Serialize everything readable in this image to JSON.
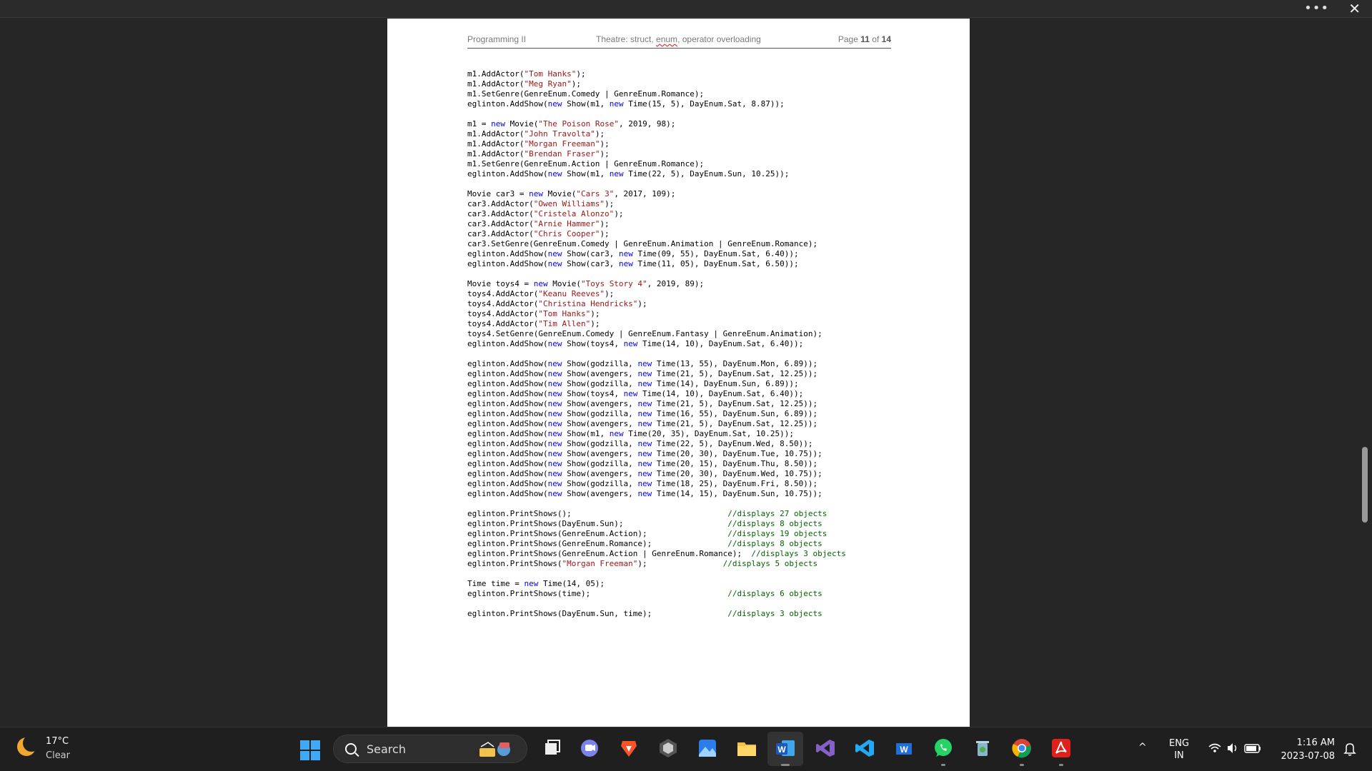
{
  "window": {
    "more_label": "•••",
    "close_label": "✕"
  },
  "document": {
    "header": {
      "left": "Programming II",
      "mid": "Theatre: struct, enum, operator overloading",
      "mid_pre": "Theatre: struct, ",
      "mid_squiggle": "enum",
      "mid_post": ", operator overloading",
      "page_word": "Page",
      "page_num": "11",
      "of_word": "of",
      "page_total": "14"
    },
    "code_lines": [
      [
        [
          "m1.AddActor(",
          ""
        ],
        [
          "\"Tom Hanks\"",
          "str"
        ],
        [
          ");",
          ""
        ]
      ],
      [
        [
          "m1.AddActor(",
          ""
        ],
        [
          "\"Meg Ryan\"",
          "str"
        ],
        [
          ");",
          ""
        ]
      ],
      [
        [
          "m1.SetGenre(GenreEnum.Comedy | GenreEnum.Romance);",
          ""
        ]
      ],
      [
        [
          "eglinton.AddShow(",
          ""
        ],
        [
          "new",
          "kw"
        ],
        [
          " Show(m1, ",
          ""
        ],
        [
          "new",
          "kw"
        ],
        [
          " Time(15, 5), DayEnum.Sat, 8.87));",
          ""
        ]
      ],
      [],
      [
        [
          "m1 = ",
          ""
        ],
        [
          "new",
          "kw"
        ],
        [
          " Movie(",
          ""
        ],
        [
          "\"The Poison Rose\"",
          "str"
        ],
        [
          ", 2019, 98);",
          ""
        ]
      ],
      [
        [
          "m1.AddActor(",
          ""
        ],
        [
          "\"John Travolta\"",
          "str"
        ],
        [
          ");",
          ""
        ]
      ],
      [
        [
          "m1.AddActor(",
          ""
        ],
        [
          "\"Morgan Freeman\"",
          "str"
        ],
        [
          ");",
          ""
        ]
      ],
      [
        [
          "m1.AddActor(",
          ""
        ],
        [
          "\"Brendan Fraser\"",
          "str"
        ],
        [
          ");",
          ""
        ]
      ],
      [
        [
          "m1.SetGenre(GenreEnum.Action | GenreEnum.Romance);",
          ""
        ]
      ],
      [
        [
          "eglinton.AddShow(",
          ""
        ],
        [
          "new",
          "kw"
        ],
        [
          " Show(m1, ",
          ""
        ],
        [
          "new",
          "kw"
        ],
        [
          " Time(22, 5), DayEnum.Sun, 10.25));",
          ""
        ]
      ],
      [],
      [
        [
          "Movie car3 = ",
          ""
        ],
        [
          "new",
          "kw"
        ],
        [
          " Movie(",
          ""
        ],
        [
          "\"Cars 3\"",
          "str"
        ],
        [
          ", 2017, 109);",
          ""
        ]
      ],
      [
        [
          "car3.AddActor(",
          ""
        ],
        [
          "\"Owen Williams\"",
          "str"
        ],
        [
          ");",
          ""
        ]
      ],
      [
        [
          "car3.AddActor(",
          ""
        ],
        [
          "\"Cristela Alonzo\"",
          "str"
        ],
        [
          ");",
          ""
        ]
      ],
      [
        [
          "car3.AddActor(",
          ""
        ],
        [
          "\"Arnie Hammer\"",
          "str"
        ],
        [
          ");",
          ""
        ]
      ],
      [
        [
          "car3.AddActor(",
          ""
        ],
        [
          "\"Chris Cooper\"",
          "str"
        ],
        [
          ");",
          ""
        ]
      ],
      [
        [
          "car3.SetGenre(GenreEnum.Comedy | GenreEnum.Animation | GenreEnum.Romance);",
          ""
        ]
      ],
      [
        [
          "eglinton.AddShow(",
          ""
        ],
        [
          "new",
          "kw"
        ],
        [
          " Show(car3, ",
          ""
        ],
        [
          "new",
          "kw"
        ],
        [
          " Time(09, 55), DayEnum.Sat, 6.40));",
          ""
        ]
      ],
      [
        [
          "eglinton.AddShow(",
          ""
        ],
        [
          "new",
          "kw"
        ],
        [
          " Show(car3, ",
          ""
        ],
        [
          "new",
          "kw"
        ],
        [
          " Time(11, 05), DayEnum.Sat, 6.50));",
          ""
        ]
      ],
      [],
      [
        [
          "Movie toys4 = ",
          ""
        ],
        [
          "new",
          "kw"
        ],
        [
          " Movie(",
          ""
        ],
        [
          "\"Toys Story 4\"",
          "str"
        ],
        [
          ", 2019, 89);",
          ""
        ]
      ],
      [
        [
          "toys4.AddActor(",
          ""
        ],
        [
          "\"Keanu Reeves\"",
          "str"
        ],
        [
          ");",
          ""
        ]
      ],
      [
        [
          "toys4.AddActor(",
          ""
        ],
        [
          "\"Christina Hendricks\"",
          "str"
        ],
        [
          ");",
          ""
        ]
      ],
      [
        [
          "toys4.AddActor(",
          ""
        ],
        [
          "\"Tom Hanks\"",
          "str"
        ],
        [
          ");",
          ""
        ]
      ],
      [
        [
          "toys4.AddActor(",
          ""
        ],
        [
          "\"Tim Allen\"",
          "str"
        ],
        [
          ");",
          ""
        ]
      ],
      [
        [
          "toys4.SetGenre(GenreEnum.Comedy | GenreEnum.Fantasy | GenreEnum.Animation);",
          ""
        ]
      ],
      [
        [
          "eglinton.AddShow(",
          ""
        ],
        [
          "new",
          "kw"
        ],
        [
          " Show(toys4, ",
          ""
        ],
        [
          "new",
          "kw"
        ],
        [
          " Time(14, 10), DayEnum.Sat, 6.40));",
          ""
        ]
      ],
      [],
      [
        [
          "eglinton.AddShow(",
          ""
        ],
        [
          "new",
          "kw"
        ],
        [
          " Show(godzilla, ",
          ""
        ],
        [
          "new",
          "kw"
        ],
        [
          " Time(13, 55), DayEnum.Mon, 6.89));",
          ""
        ]
      ],
      [
        [
          "eglinton.AddShow(",
          ""
        ],
        [
          "new",
          "kw"
        ],
        [
          " Show(avengers, ",
          ""
        ],
        [
          "new",
          "kw"
        ],
        [
          " Time(21, 5), DayEnum.Sat, 12.25));",
          ""
        ]
      ],
      [
        [
          "eglinton.AddShow(",
          ""
        ],
        [
          "new",
          "kw"
        ],
        [
          " Show(godzilla, ",
          ""
        ],
        [
          "new",
          "kw"
        ],
        [
          " Time(14), DayEnum.Sun, 6.89));",
          ""
        ]
      ],
      [
        [
          "eglinton.AddShow(",
          ""
        ],
        [
          "new",
          "kw"
        ],
        [
          " Show(toys4, ",
          ""
        ],
        [
          "new",
          "kw"
        ],
        [
          " Time(14, 10), DayEnum.Sat, 6.40));",
          ""
        ]
      ],
      [
        [
          "eglinton.AddShow(",
          ""
        ],
        [
          "new",
          "kw"
        ],
        [
          " Show(avengers, ",
          ""
        ],
        [
          "new",
          "kw"
        ],
        [
          " Time(21, 5), DayEnum.Sat, 12.25));",
          ""
        ]
      ],
      [
        [
          "eglinton.AddShow(",
          ""
        ],
        [
          "new",
          "kw"
        ],
        [
          " Show(godzilla, ",
          ""
        ],
        [
          "new",
          "kw"
        ],
        [
          " Time(16, 55), DayEnum.Sun, 6.89));",
          ""
        ]
      ],
      [
        [
          "eglinton.AddShow(",
          ""
        ],
        [
          "new",
          "kw"
        ],
        [
          " Show(avengers, ",
          ""
        ],
        [
          "new",
          "kw"
        ],
        [
          " Time(21, 5), DayEnum.Sat, 12.25));",
          ""
        ]
      ],
      [
        [
          "eglinton.AddShow(",
          ""
        ],
        [
          "new",
          "kw"
        ],
        [
          " Show(m1, ",
          ""
        ],
        [
          "new",
          "kw"
        ],
        [
          " Time(20, 35), DayEnum.Sat, 10.25));",
          ""
        ]
      ],
      [
        [
          "eglinton.AddShow(",
          ""
        ],
        [
          "new",
          "kw"
        ],
        [
          " Show(godzilla, ",
          ""
        ],
        [
          "new",
          "kw"
        ],
        [
          " Time(22, 5), DayEnum.Wed, 8.50));",
          ""
        ]
      ],
      [
        [
          "eglinton.AddShow(",
          ""
        ],
        [
          "new",
          "kw"
        ],
        [
          " Show(avengers, ",
          ""
        ],
        [
          "new",
          "kw"
        ],
        [
          " Time(20, 30), DayEnum.Tue, 10.75));",
          ""
        ]
      ],
      [
        [
          "eglinton.AddShow(",
          ""
        ],
        [
          "new",
          "kw"
        ],
        [
          " Show(godzilla, ",
          ""
        ],
        [
          "new",
          "kw"
        ],
        [
          " Time(20, 15), DayEnum.Thu, 8.50));",
          ""
        ]
      ],
      [
        [
          "eglinton.AddShow(",
          ""
        ],
        [
          "new",
          "kw"
        ],
        [
          " Show(avengers, ",
          ""
        ],
        [
          "new",
          "kw"
        ],
        [
          " Time(20, 30), DayEnum.Wed, 10.75));",
          ""
        ]
      ],
      [
        [
          "eglinton.AddShow(",
          ""
        ],
        [
          "new",
          "kw"
        ],
        [
          " Show(godzilla, ",
          ""
        ],
        [
          "new",
          "kw"
        ],
        [
          " Time(18, 25), DayEnum.Fri, 8.50));",
          ""
        ]
      ],
      [
        [
          "eglinton.AddShow(",
          ""
        ],
        [
          "new",
          "kw"
        ],
        [
          " Show(avengers, ",
          ""
        ],
        [
          "new",
          "kw"
        ],
        [
          " Time(14, 15), DayEnum.Sun, 10.75));",
          ""
        ]
      ],
      [],
      [
        [
          "eglinton.PrintShows();                                 ",
          ""
        ],
        [
          "//displays 27 objects",
          "cm"
        ]
      ],
      [
        [
          "eglinton.PrintShows(DayEnum.Sun);                      ",
          ""
        ],
        [
          "//displays 8 objects",
          "cm"
        ]
      ],
      [
        [
          "eglinton.PrintShows(GenreEnum.Action);                 ",
          ""
        ],
        [
          "//displays 19 objects",
          "cm"
        ]
      ],
      [
        [
          "eglinton.PrintShows(GenreEnum.Romance);                ",
          ""
        ],
        [
          "//displays 8 objects",
          "cm"
        ]
      ],
      [
        [
          "eglinton.PrintShows(GenreEnum.Action | GenreEnum.Romance);  ",
          ""
        ],
        [
          "//displays 3 objects",
          "cm"
        ]
      ],
      [
        [
          "eglinton.PrintShows(",
          ""
        ],
        [
          "\"Morgan Freeman\"",
          "str"
        ],
        [
          ");                ",
          ""
        ],
        [
          "//displays 5 objects",
          "cm"
        ]
      ],
      [],
      [
        [
          "Time time = ",
          ""
        ],
        [
          "new",
          "kw"
        ],
        [
          " Time(14, 05);",
          ""
        ]
      ],
      [
        [
          "eglinton.PrintShows(time);                             ",
          ""
        ],
        [
          "//displays 6 objects",
          "cm"
        ]
      ],
      [],
      [
        [
          "eglinton.PrintShows(DayEnum.Sun, time);                ",
          ""
        ],
        [
          "//displays 3 objects",
          "cm"
        ]
      ]
    ]
  },
  "taskbar": {
    "weather_temp": "17°C",
    "weather_cond": "Clear",
    "search_label": "Search",
    "apps": [
      "task-view-icon",
      "teams-chat-icon",
      "brave-icon",
      "obsidian-icon",
      "photos-icon",
      "file-explorer-icon",
      "word-icon",
      "visual-studio-icon",
      "vscode-icon",
      "word-blue-icon",
      "whatsapp-icon",
      "recycle-icon",
      "chrome-icon",
      "acrobat-icon"
    ],
    "tray_up": "^",
    "lang_line1": "ENG",
    "lang_line2": "IN",
    "time": "1:16 AM",
    "date": "2023-07-08"
  },
  "colors": {
    "keyword": "#0000ff",
    "string": "#a31515",
    "comment": "#006400",
    "windows_blue": "#3fa9f5"
  }
}
